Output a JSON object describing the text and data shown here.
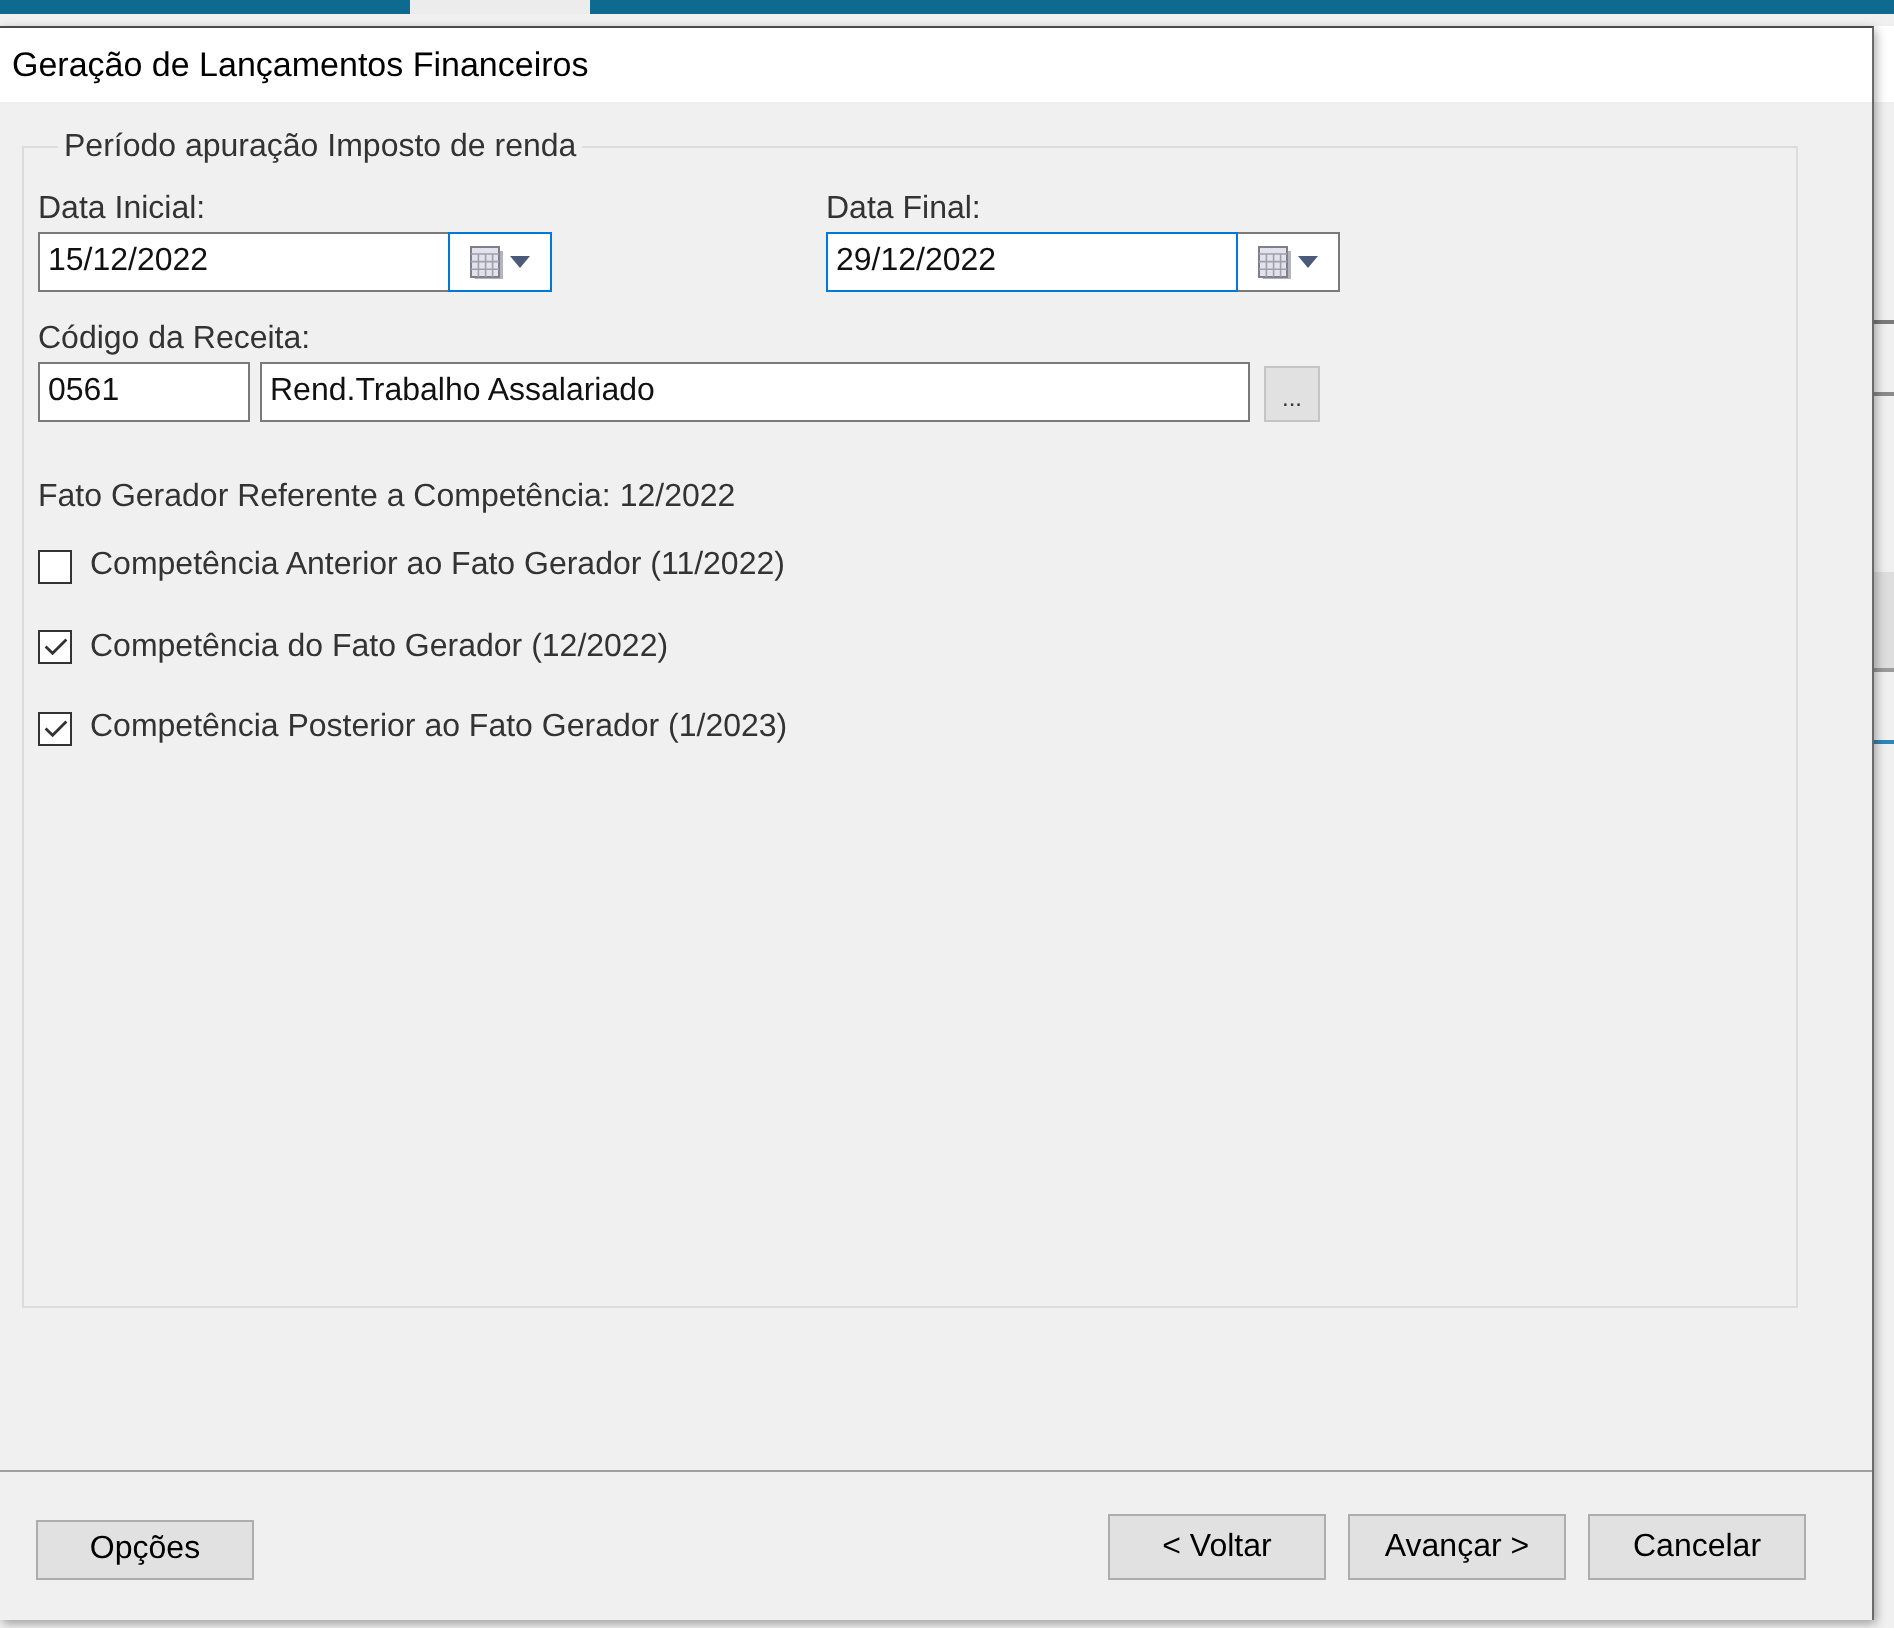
{
  "window": {
    "title": "Geração de Lançamentos Financeiros"
  },
  "group": {
    "legend": "Período apuração Imposto de renda",
    "date_fields": [
      {
        "label": "Data Inicial:",
        "value": "15/12/2022",
        "input_highlighted": false,
        "button_highlighted": true
      },
      {
        "label": "Data Final:",
        "value": "29/12/2022",
        "input_highlighted": true,
        "button_highlighted": false
      }
    ],
    "revenue_code": {
      "label": "Código da Receita:",
      "code": "0561",
      "description": "Rend.Trabalho Assalariado",
      "browse_button": "..."
    },
    "reference_text": "Fato Gerador Referente a Competência: 12/2022",
    "options": [
      {
        "label": "Competência Anterior ao Fato Gerador (11/2022)",
        "checked": false
      },
      {
        "label": "Competência do Fato Gerador (12/2022)",
        "checked": true
      },
      {
        "label": "Competência Posterior ao Fato Gerador (1/2023)",
        "checked": true
      }
    ]
  },
  "footer": {
    "buttons": [
      {
        "kind": "options",
        "label": "Opções"
      },
      {
        "kind": "back",
        "label": "< Voltar"
      },
      {
        "kind": "next",
        "label": "Avançar >"
      },
      {
        "kind": "cancel",
        "label": "Cancelar"
      }
    ]
  }
}
